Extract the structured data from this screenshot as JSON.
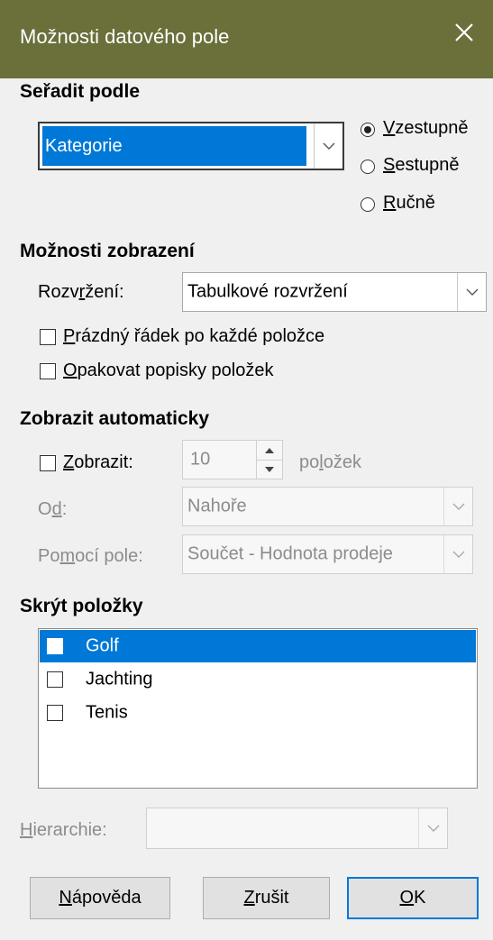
{
  "window": {
    "title": "Možnosti datového pole",
    "close_icon": "close-icon",
    "titlebar_color": "#6b6f3a"
  },
  "sort": {
    "heading": "Seřadit podle",
    "field_value": "Kategorie",
    "options": [
      "Vzestupně",
      "Sestupně",
      "Ručně"
    ],
    "selected": "Vzestupně"
  },
  "display": {
    "heading": "Možnosti zobrazení",
    "layout_label": "Rozvržení:",
    "layout_value": "Tabulkové rozvržení",
    "empty_line_label": "Prázdný řádek po každé položce",
    "empty_line_checked": false,
    "repeat_labels_label": "Opakovat popisky položek",
    "repeat_labels_checked": false
  },
  "autoshow": {
    "heading": "Zobrazit automaticky",
    "show_label": "Zobrazit:",
    "show_checked": false,
    "count_value": "10",
    "items_label": "položek",
    "from_label": "Od:",
    "from_value": "Nahoře",
    "using_label": "Pomocí pole:",
    "using_value": "Součet - Hodnota prodeje"
  },
  "hide": {
    "heading": "Skrýt položky",
    "items": [
      {
        "label": "Golf",
        "checked": false,
        "selected": true
      },
      {
        "label": "Jachting",
        "checked": false,
        "selected": false
      },
      {
        "label": "Tenis",
        "checked": false,
        "selected": false
      }
    ]
  },
  "hierarchy": {
    "label": "Hierarchie:",
    "value": ""
  },
  "buttons": {
    "help": "Nápověda",
    "cancel": "Zrušit",
    "ok": "OK"
  },
  "colors": {
    "accent": "#0078d7"
  }
}
